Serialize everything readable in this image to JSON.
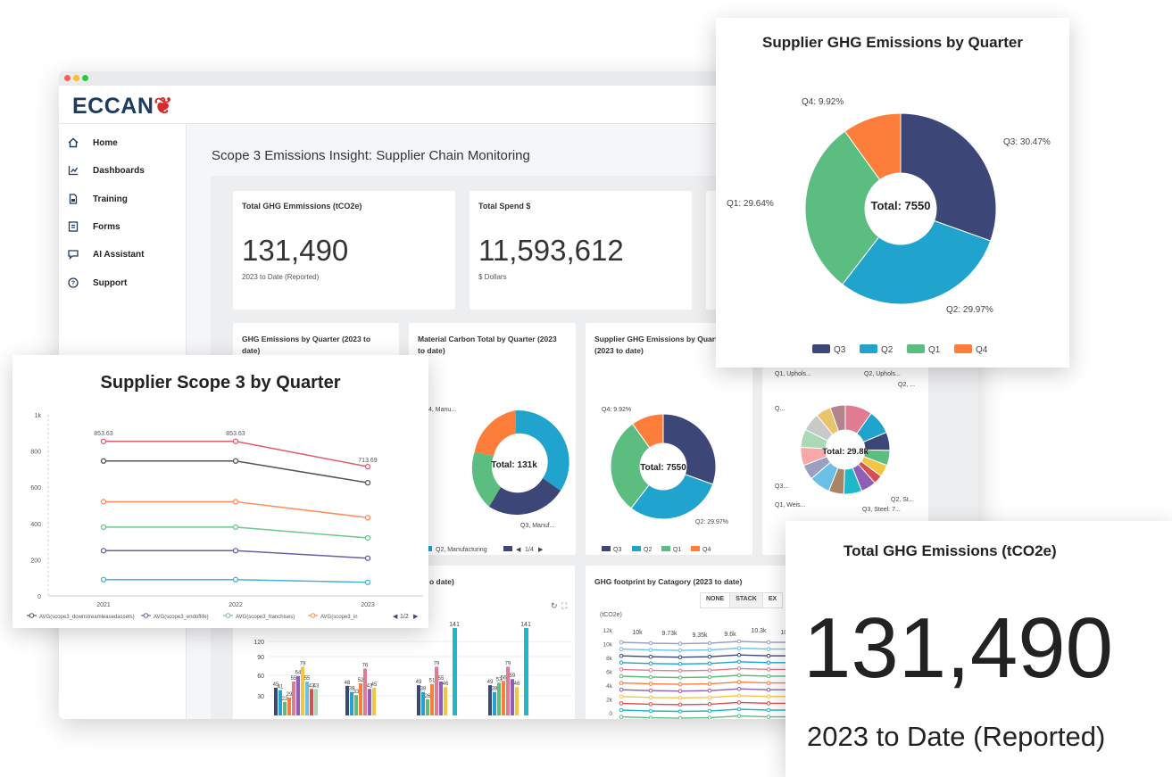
{
  "app": {
    "logo_text": "ECCAN",
    "window_dots": [
      "#ff5f56",
      "#ffbd2e",
      "#27c93f"
    ]
  },
  "sidebar": {
    "items": [
      {
        "label": "Home",
        "icon": "home-icon"
      },
      {
        "label": "Dashboards",
        "icon": "dashboard-icon"
      },
      {
        "label": "Training",
        "icon": "training-icon"
      },
      {
        "label": "Forms",
        "icon": "forms-icon"
      },
      {
        "label": "AI Assistant",
        "icon": "chat-icon"
      },
      {
        "label": "Support",
        "icon": "help-icon"
      }
    ]
  },
  "main": {
    "title": "Scope 3 Emissions Insight: Supplier Chain Monitoring",
    "kpis": [
      {
        "label": "Total GHG Emmissions (tCO2e)",
        "value": "131,490",
        "sub": "2023 to Date (Reported)"
      },
      {
        "label": "Total Spend $",
        "value": "11,593,612",
        "sub": "$ Dollars"
      }
    ],
    "charts": [
      {
        "title": "GHG Emissions by Quarter (2023 to date)"
      },
      {
        "title": "Material Carbon Total by Quarter (2023 to date)",
        "center": "Total: 131k",
        "labels": [
          "4, Manu...",
          "Q3, Manuf..."
        ],
        "legend": [
          "Q2, Manufacturing"
        ],
        "pager": "1/4"
      },
      {
        "title": "Supplier GHG Emissions by Quarter (2023 to date)",
        "center": "Total: 7550",
        "labels": [
          "Q4: 9.92%",
          "Q2: 29.97%"
        ],
        "legend": [
          "Q3",
          "Q2",
          "Q1",
          "Q4"
        ]
      },
      {
        "title": "",
        "center": "Total: 29.8k",
        "labels": [
          "Q1, Uphols...",
          "Q2, Uphols...",
          "Q2, ...",
          "Q...",
          "Q3...",
          "Q1, Weis...",
          "Q3, Steel: 7...",
          "Q2, St..."
        ]
      },
      {
        "title": "o date)"
      },
      {
        "title": "GHG footprint by Catagory (2023 to date)",
        "buttons": [
          "NONE",
          "STACK",
          "EX"
        ],
        "unit": "(tCO2e)",
        "top_labels": [
          "10k",
          "9.73k",
          "9.35k",
          "9.6k",
          "10.3k",
          "10k"
        ]
      }
    ],
    "bar_chart": {
      "y_ticks": [
        "120",
        "90",
        "60",
        "30"
      ],
      "top_labels": [
        "141",
        "141"
      ],
      "group_labels": [
        [
          "45",
          "41",
          "22",
          "29",
          "55",
          "64",
          "79",
          "55",
          "43",
          "43"
        ],
        [
          "48",
          "38",
          "33",
          "52",
          "76",
          "43",
          "45"
        ],
        [
          "49",
          "38",
          "26",
          "51",
          "79",
          "55",
          "46"
        ],
        [
          "49",
          "38",
          "53",
          "56",
          "79",
          "59",
          "46"
        ]
      ]
    },
    "footprint_axis": [
      "12k",
      "10k",
      "8k",
      "6k",
      "4k",
      "2k",
      "0"
    ]
  },
  "overlay_pie": {
    "title": "Supplier GHG Emissions by Quarter",
    "center": "Total: 7550",
    "labels": {
      "Q3": "Q3: 30.47%",
      "Q2": "Q2: 29.97%",
      "Q1": "Q1: 29.64%",
      "Q4": "Q4: 9.92%"
    }
  },
  "overlay_line": {
    "title": "Supplier Scope 3 by Quarter",
    "value_labels": [
      "853.63",
      "853.63",
      "713.69"
    ],
    "y_tick_labels": [
      "1k",
      "800",
      "600",
      "400",
      "200",
      "0"
    ],
    "x_tick_labels": [
      "2021",
      "2022",
      "2023"
    ],
    "legend": [
      "AVG(scope3_downstreamleasedassets)",
      "AVG(scope3_endoflife)",
      "AVG(scope3_franchises)",
      "AVG(scope3_in"
    ],
    "pager": "1/2"
  },
  "overlay_kpi": {
    "label": "Total GHG Emissions (tCO2e)",
    "value": "131,490",
    "sub": "2023 to Date (Reported)"
  },
  "chart_data": [
    {
      "type": "pie",
      "title": "Supplier GHG Emissions by Quarter",
      "categories": [
        "Q3",
        "Q2",
        "Q1",
        "Q4"
      ],
      "values": [
        30.47,
        29.97,
        29.64,
        9.92
      ],
      "colors": [
        "#3c4777",
        "#20a3cc",
        "#5cbd81",
        "#fd7d3a"
      ],
      "total": 7550,
      "legend": "bottom"
    },
    {
      "type": "line",
      "title": "Supplier Scope 3 by Quarter",
      "x": [
        "2021",
        "2022",
        "2023"
      ],
      "ylim": [
        0,
        1000
      ],
      "series": [
        {
          "name": "",
          "color": "#e05c6c",
          "values": [
            853.63,
            853.63,
            713.69
          ]
        },
        {
          "name": "",
          "color": "#555555",
          "values": [
            745,
            745,
            625
          ]
        },
        {
          "name": "",
          "color": "#fd8c5a",
          "values": [
            520,
            520,
            432
          ]
        },
        {
          "name": "",
          "color": "#6cc78c",
          "values": [
            380,
            380,
            320
          ]
        },
        {
          "name": "",
          "color": "#6a5fa6",
          "values": [
            250,
            250,
            208
          ]
        },
        {
          "name": "",
          "color": "#45b3d6",
          "values": [
            90,
            90,
            75
          ]
        }
      ],
      "legend": "bottom"
    }
  ]
}
